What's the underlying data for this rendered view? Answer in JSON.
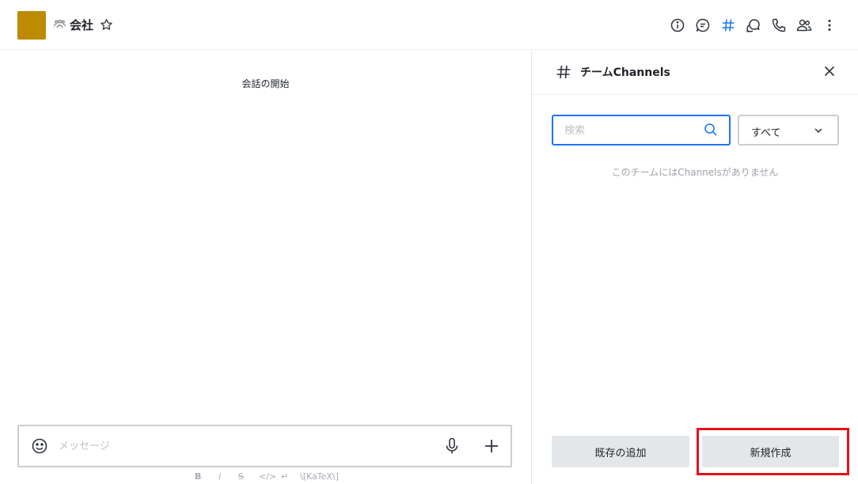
{
  "header": {
    "avatar_color": "#bc8b00",
    "title": "会社",
    "icons": [
      "team-icon",
      "star-icon",
      "info-icon",
      "threads-icon",
      "channels-icon",
      "discussion-icon",
      "call-icon",
      "members-icon",
      "kebab-menu-icon"
    ],
    "active_icon": "channels-icon"
  },
  "main": {
    "start_text": "会話の開始",
    "composer": {
      "placeholder": "メッセージ",
      "format_items": [
        "B",
        "i",
        "S",
        "</>",
        "↵",
        "\\[KaTeX\\]"
      ]
    }
  },
  "panel": {
    "title": "チームChannels",
    "search_placeholder": "検索",
    "filter_value": "すべて",
    "empty_text": "このチームにはChannelsがありません",
    "add_existing_label": "既存の追加",
    "create_new_label": "新規作成"
  },
  "colors": {
    "accent": "#1d74f5",
    "highlight": "#e3101a",
    "button_bg": "#e4e7ea",
    "icon": "#2f343d"
  }
}
